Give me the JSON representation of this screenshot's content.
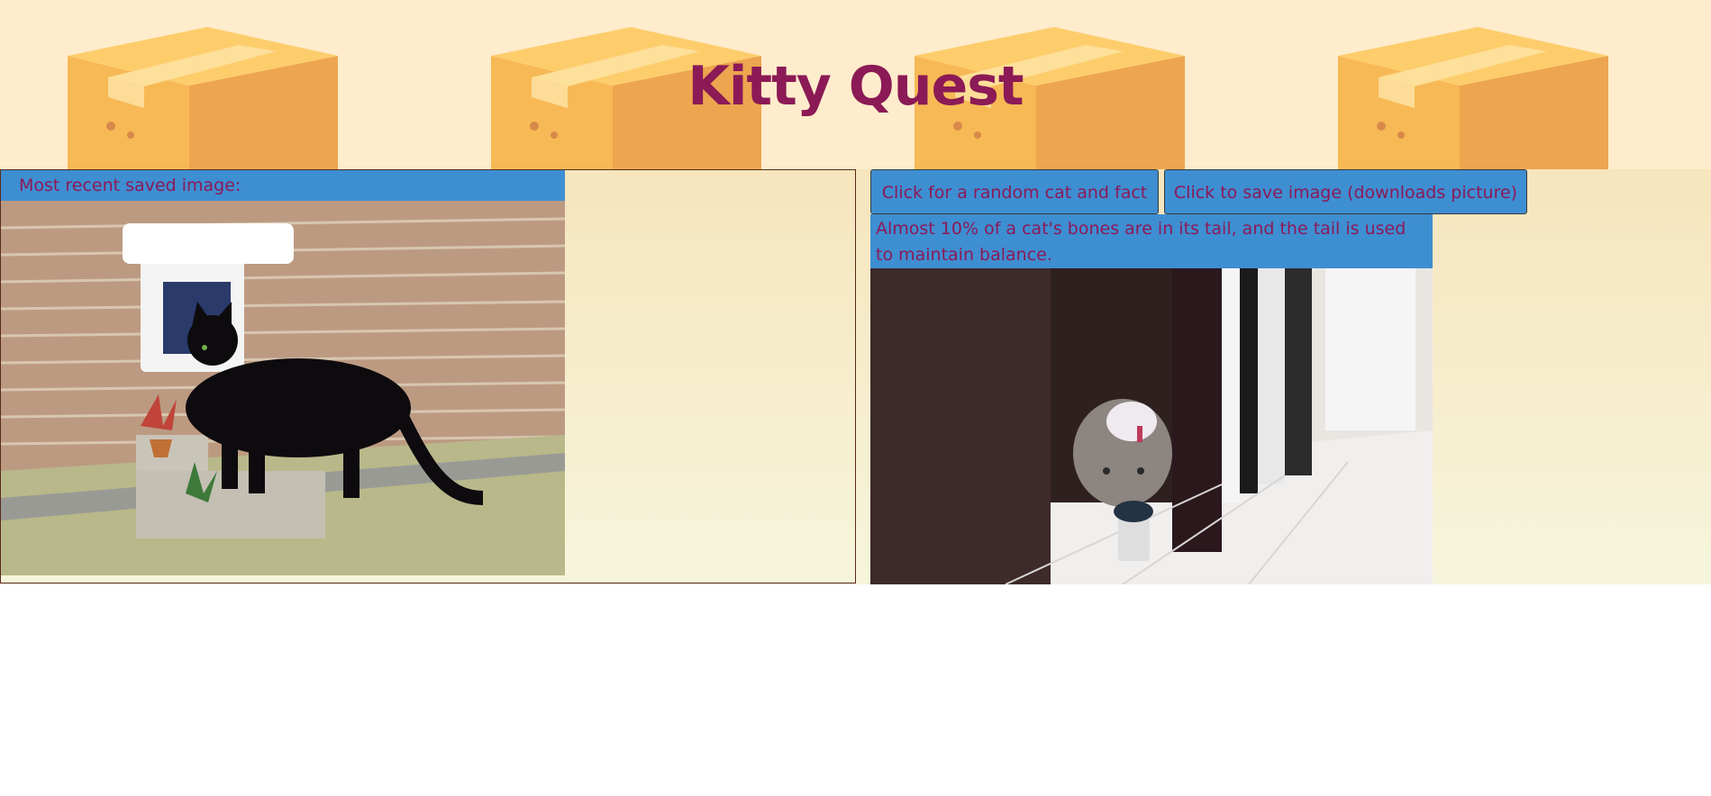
{
  "header": {
    "title": "Kitty Quest"
  },
  "saved_panel": {
    "label": "Most recent saved image:",
    "image_icon": "black-cat-photo"
  },
  "actions": {
    "random_button_label": "Click for a random cat and fact",
    "save_button_label": "Click to save image (downloads picture)"
  },
  "fact": {
    "text": "Almost 10% of a cat's bones are in its tail, and the tail is used to maintain balance."
  },
  "random_panel": {
    "image_icon": "tabby-cat-photo"
  },
  "colors": {
    "accent": "#3e8ed2",
    "title": "#8b1a56",
    "header_bg": "#ffeccc"
  }
}
